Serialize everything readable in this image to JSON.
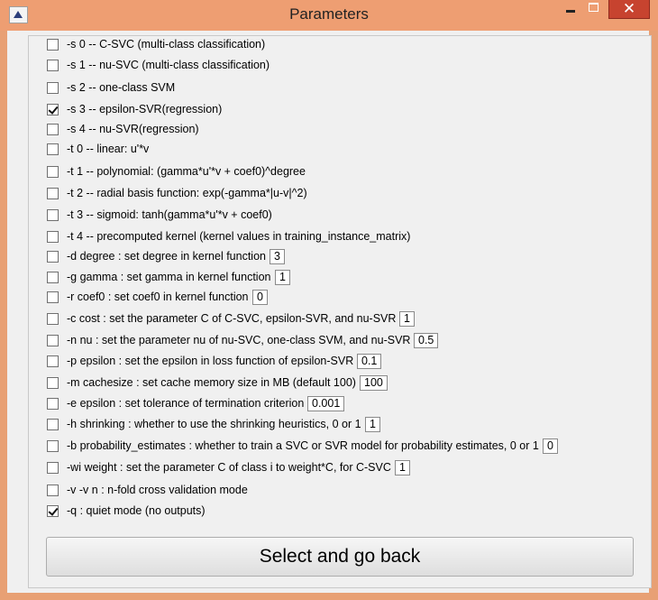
{
  "window": {
    "title": "Parameters",
    "close_symbol": "✕",
    "accent_color": "#ee9e72",
    "close_color": "#c7432f"
  },
  "options": [
    {
      "id": "s0",
      "label": "-s 0 -- C-SVC (multi-class classification)",
      "checked": false
    },
    {
      "id": "s1",
      "label": "-s 1 -- nu-SVC (multi-class classification)",
      "checked": false
    },
    {
      "id": "s2",
      "label": "-s 2 -- one-class SVM",
      "checked": false
    },
    {
      "id": "s3",
      "label": "-s 3 -- epsilon-SVR(regression)",
      "checked": true
    },
    {
      "id": "s4",
      "label": "-s 4 -- nu-SVR(regression)",
      "checked": false
    },
    {
      "id": "t0",
      "label": "-t 0 -- linear: u'*v",
      "checked": false
    },
    {
      "id": "t1",
      "label": "-t 1 -- polynomial: (gamma*u'*v + coef0)^degree",
      "checked": false
    },
    {
      "id": "t2",
      "label": "-t 2 -- radial basis function: exp(-gamma*|u-v|^2)",
      "checked": false
    },
    {
      "id": "t3",
      "label": "-t 3 -- sigmoid: tanh(gamma*u'*v + coef0)",
      "checked": false
    },
    {
      "id": "t4",
      "label": "-t 4 -- precomputed kernel (kernel values in training_instance_matrix)",
      "checked": false
    },
    {
      "id": "d",
      "label": "-d degree : set degree in kernel function",
      "checked": false,
      "value": "3"
    },
    {
      "id": "g",
      "label": "-g gamma : set gamma in kernel function",
      "checked": false,
      "value": "1"
    },
    {
      "id": "r",
      "label": "-r coef0 : set coef0 in kernel function",
      "checked": false,
      "value": "0"
    },
    {
      "id": "c",
      "label": "-c cost : set the parameter C of C-SVC, epsilon-SVR, and nu-SVR",
      "checked": false,
      "value": "1"
    },
    {
      "id": "n",
      "label": "-n nu : set the parameter nu of nu-SVC, one-class SVM, and nu-SVR",
      "checked": false,
      "value": "0.5"
    },
    {
      "id": "p",
      "label": "-p epsilon : set the epsilon in loss function of epsilon-SVR",
      "checked": false,
      "value": "0.1"
    },
    {
      "id": "m",
      "label": "-m cachesize : set cache memory size in MB (default 100)",
      "checked": false,
      "value": "100"
    },
    {
      "id": "e",
      "label": "-e epsilon : set tolerance of termination criterion",
      "checked": false,
      "value": "0.001"
    },
    {
      "id": "h",
      "label": "-h shrinking : whether to use the shrinking heuristics, 0 or 1",
      "checked": false,
      "value": "1"
    },
    {
      "id": "b",
      "label": "-b probability_estimates : whether to train a SVC or SVR model for probability estimates, 0 or 1",
      "checked": false,
      "value": "0"
    },
    {
      "id": "wi",
      "label": "-wi weight : set the parameter C of class i to weight*C, for C-SVC",
      "checked": false,
      "value": "1"
    },
    {
      "id": "v",
      "label": "-v -v n : n-fold cross validation mode",
      "checked": false
    },
    {
      "id": "q",
      "label": "-q : quiet mode (no outputs)",
      "checked": true
    }
  ],
  "submit": {
    "label": "Select and go back"
  }
}
